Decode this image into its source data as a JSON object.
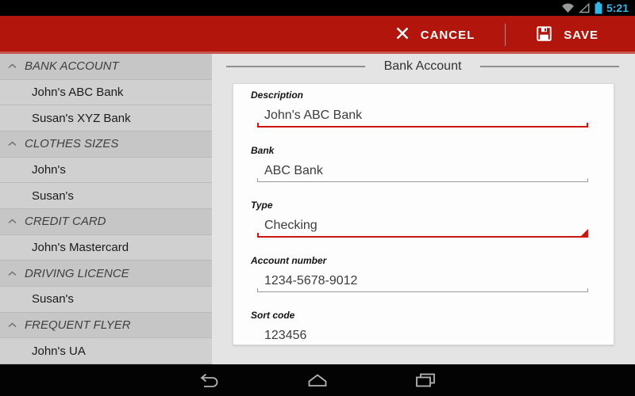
{
  "status_bar": {
    "time": "5:21"
  },
  "action_bar": {
    "cancel_label": "CANCEL",
    "save_label": "SAVE"
  },
  "sidebar": {
    "rows": [
      {
        "type": "header",
        "label": "BANK ACCOUNT"
      },
      {
        "type": "item",
        "label": "John's ABC Bank"
      },
      {
        "type": "item",
        "label": "Susan's XYZ Bank"
      },
      {
        "type": "header",
        "label": "CLOTHES SIZES"
      },
      {
        "type": "item",
        "label": "John's"
      },
      {
        "type": "item",
        "label": "Susan's"
      },
      {
        "type": "header",
        "label": "CREDIT CARD"
      },
      {
        "type": "item",
        "label": "John's Mastercard"
      },
      {
        "type": "header",
        "label": "DRIVING LICENCE"
      },
      {
        "type": "item",
        "label": "Susan's"
      },
      {
        "type": "header",
        "label": "FREQUENT FLYER"
      },
      {
        "type": "item",
        "label": "John's UA"
      }
    ]
  },
  "form": {
    "title": "Bank Account",
    "fields": [
      {
        "label": "Description",
        "value": "John's ABC Bank",
        "state": "focused"
      },
      {
        "label": "Bank",
        "value": "ABC Bank",
        "state": "normal"
      },
      {
        "label": "Type",
        "value": "Checking",
        "state": "spinner"
      },
      {
        "label": "Account number",
        "value": "1234-5678-9012",
        "state": "normal"
      },
      {
        "label": "Sort code",
        "value": "123456",
        "state": "plain"
      }
    ]
  },
  "colors": {
    "action_bar_red": "#b1150b",
    "accent_underline_red": "#cb1710",
    "holo_blue": "#33b5e5",
    "content_bg": "#e4e4e4",
    "sidebar_header_bg": "#c6c6c6",
    "sidebar_item_bg": "#d0d0d0"
  }
}
